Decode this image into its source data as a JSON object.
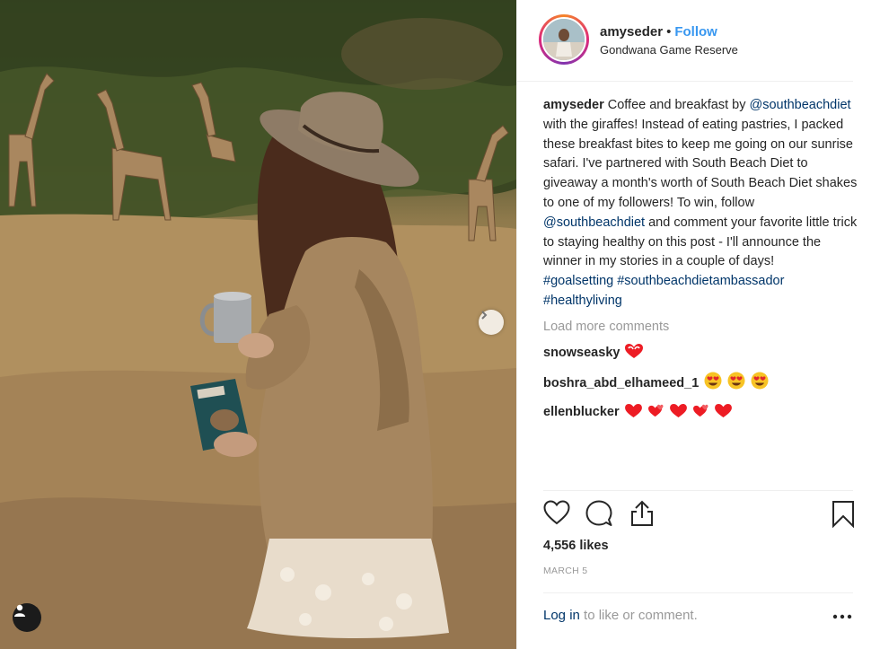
{
  "post": {
    "username": "amyseder",
    "separator": "•",
    "follow_label": "Follow",
    "location": "Gondwana Game Reserve",
    "caption": {
      "user": "amyseder",
      "text_1": "Coffee and breakfast by",
      "mention_1": "@southbeachdiet",
      "text_2": "with the giraffes! Instead of eating pastries, I packed these breakfast bites to keep me going on our sunrise safari. I've partnered with South Beach Diet to giveaway a month's worth of South Beach Diet shakes to one of my followers! To win, follow",
      "mention_2": "@southbeachdiet",
      "text_3": "and comment your favorite little trick to staying healthy  on this post - I'll announce the winner in my stories in a couple of days!",
      "hashtags": [
        "#goalsetting",
        "#southbeachdietambassador",
        "#healthyliving"
      ]
    },
    "load_more_label": "Load more comments",
    "comments": [
      {
        "user": "snowseasky",
        "emojis": [
          "heart-eyes-heart"
        ]
      },
      {
        "user": "boshra_abd_elhameed_1",
        "emojis": [
          "heart-eyes-face",
          "heart-eyes-face",
          "heart-eyes-face"
        ]
      },
      {
        "user": "ellenblucker",
        "emojis": [
          "red-heart",
          "two-hearts",
          "red-heart",
          "two-hearts",
          "red-heart"
        ]
      }
    ],
    "likes": "4,556 likes",
    "date": "MARCH 5",
    "login_link": "Log in",
    "login_suffix": "to like or comment."
  },
  "colors": {
    "link_blue": "#003569",
    "follow_blue": "#3897f0",
    "muted_gray": "#999999",
    "heart_red": "#ed1c24"
  },
  "icons": [
    "chevron-right-icon",
    "user-tag-icon",
    "heart-icon",
    "comment-icon",
    "share-icon",
    "bookmark-icon",
    "more-options-icon"
  ]
}
